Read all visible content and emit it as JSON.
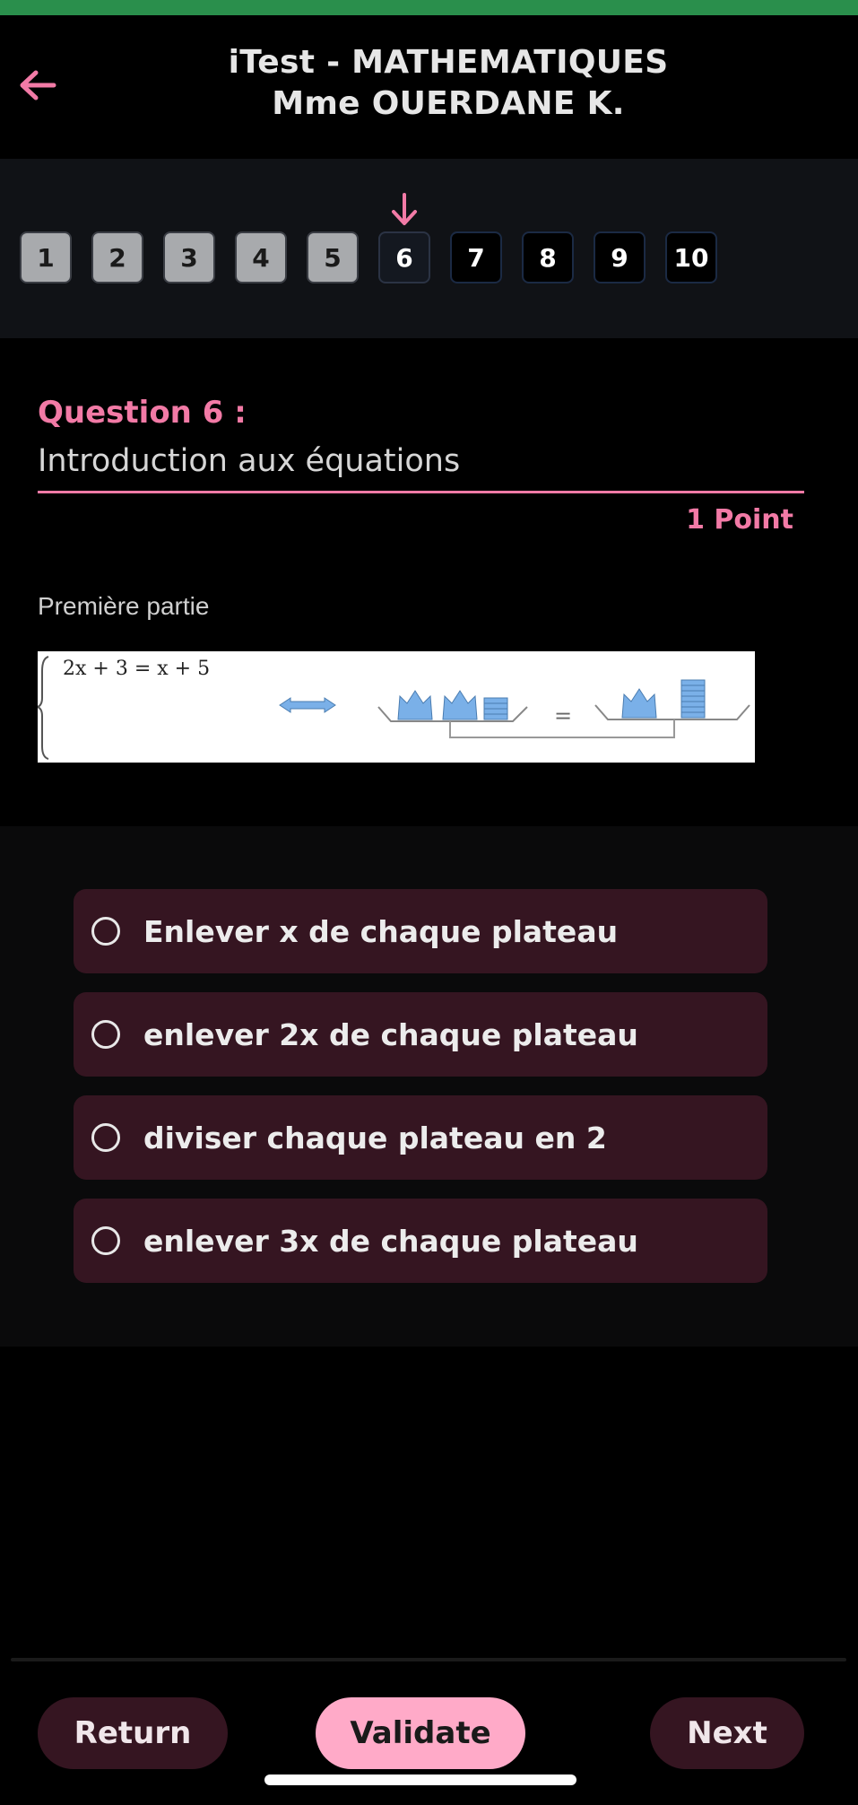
{
  "header": {
    "title": "iTest - MATHEMATIQUES",
    "subtitle": "Mme OUERDANE K.",
    "back_icon": "arrow-left-icon",
    "accent_color": "#f27aa6"
  },
  "navigation": {
    "current_marker_icon": "arrow-down-icon",
    "questions": [
      {
        "label": "1",
        "state": "answered"
      },
      {
        "label": "2",
        "state": "answered"
      },
      {
        "label": "3",
        "state": "answered"
      },
      {
        "label": "4",
        "state": "answered"
      },
      {
        "label": "5",
        "state": "answered"
      },
      {
        "label": "6",
        "state": "current"
      },
      {
        "label": "7",
        "state": "unanswered"
      },
      {
        "label": "8",
        "state": "unanswered"
      },
      {
        "label": "9",
        "state": "unanswered"
      },
      {
        "label": "10",
        "state": "unanswered"
      }
    ]
  },
  "question": {
    "number_label": "Question 6 :",
    "title": "Introduction aux équations",
    "points": "1 Point",
    "part": "Première partie",
    "image_equation": "2x + 3 = x + 5",
    "image_equals": "="
  },
  "answers": [
    {
      "label": "Enlever x de chaque plateau",
      "selected": false
    },
    {
      "label": "enlever 2x de chaque plateau",
      "selected": false
    },
    {
      "label": "diviser chaque plateau en 2",
      "selected": false
    },
    {
      "label": "enlever 3x de chaque plateau",
      "selected": false
    }
  ],
  "footer": {
    "return_label": "Return",
    "validate_label": "Validate",
    "next_label": "Next"
  }
}
